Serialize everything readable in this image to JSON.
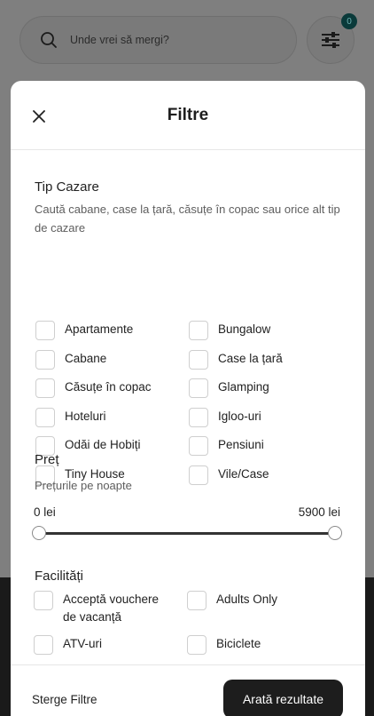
{
  "background": {
    "search_placeholder": "Unde vrei să mergi?",
    "filter_count": "0"
  },
  "sheet": {
    "title": "Filtre",
    "accommodation": {
      "title": "Tip Cazare",
      "subtitle": "Caută cabane, case la țară, căsuțe în copac sau orice alt tip de cazare",
      "options_left": [
        "Apartamente",
        "Cabane",
        "Căsuțe în copac",
        "Hoteluri",
        "Odăi de Hobiți",
        "Tiny House"
      ],
      "options_right": [
        "Bungalow",
        "Case la țară",
        "Glamping",
        "Igloo-uri",
        "Pensiuni",
        "Vile/Case"
      ]
    },
    "price": {
      "title": "Preț",
      "subtitle": "Prețurile pe noapte",
      "min_label": "0 lei",
      "max_label": "5900 lei",
      "min_value": 0,
      "max_value": 5900
    },
    "facilities": {
      "title": "Facilități",
      "options_left": [
        "Acceptă vouchere de vacanță",
        "ATV-uri"
      ],
      "options_right": [
        "Adults Only",
        "Biciclete"
      ]
    },
    "footer": {
      "clear_label": "Sterge Filtre",
      "show_label": "Arată rezultate"
    }
  },
  "colors": {
    "accent": "#1d1d1d",
    "badge_bg": "#0a3a3a"
  }
}
